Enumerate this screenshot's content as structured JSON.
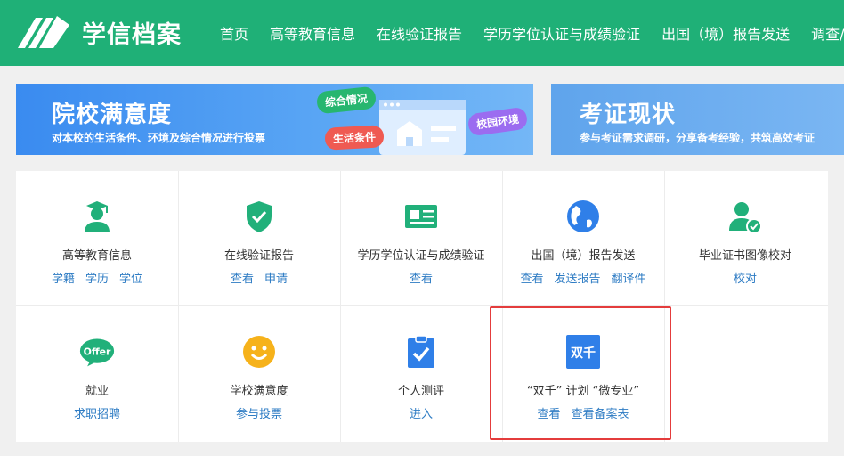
{
  "header": {
    "logo_text": "学信档案",
    "nav": [
      "首页",
      "高等教育信息",
      "在线验证报告",
      "学历学位认证与成绩验证",
      "出国（境）报告发送",
      "调查/"
    ]
  },
  "banners": [
    {
      "title": "院校满意度",
      "subtitle": "对本校的生活条件、环境及综合情况进行投票",
      "tags": [
        "综合情况",
        "生活条件",
        "校园环境"
      ]
    },
    {
      "title": "考证现状",
      "subtitle": "参与考证需求调研，分享备考经验，共筑高效考证"
    }
  ],
  "services": [
    {
      "title": "高等教育信息",
      "links": [
        "学籍",
        "学历",
        "学位"
      ],
      "icon": "graduate-icon",
      "color": "#21b07a"
    },
    {
      "title": "在线验证报告",
      "links": [
        "查看",
        "申请"
      ],
      "icon": "shield-check-icon",
      "color": "#21b07a"
    },
    {
      "title": "学历学位认证与成绩验证",
      "links": [
        "查看"
      ],
      "icon": "id-card-icon",
      "color": "#21b07a"
    },
    {
      "title": "出国（境）报告发送",
      "links": [
        "查看",
        "发送报告",
        "翻译件"
      ],
      "icon": "globe-icon",
      "color": "#2f7fe8"
    },
    {
      "title": "毕业证书图像校对",
      "links": [
        "校对"
      ],
      "icon": "user-check-icon",
      "color": "#21b07a"
    },
    {
      "title": "就业",
      "links": [
        "求职招聘"
      ],
      "icon": "offer-icon",
      "icon_text": "Offer",
      "color": "#21b07a"
    },
    {
      "title": "学校满意度",
      "links": [
        "参与投票"
      ],
      "icon": "smiley-icon",
      "color": "#f6b21b"
    },
    {
      "title": "个人测评",
      "links": [
        "进入"
      ],
      "icon": "clipboard-check-icon",
      "color": "#2f7fe8"
    },
    {
      "title": "“双千” 计划 “微专业”",
      "links": [
        "查看",
        "查看备案表"
      ],
      "icon": "shuangqian-icon",
      "icon_text": "双千",
      "color": "#2f7fe8"
    }
  ]
}
